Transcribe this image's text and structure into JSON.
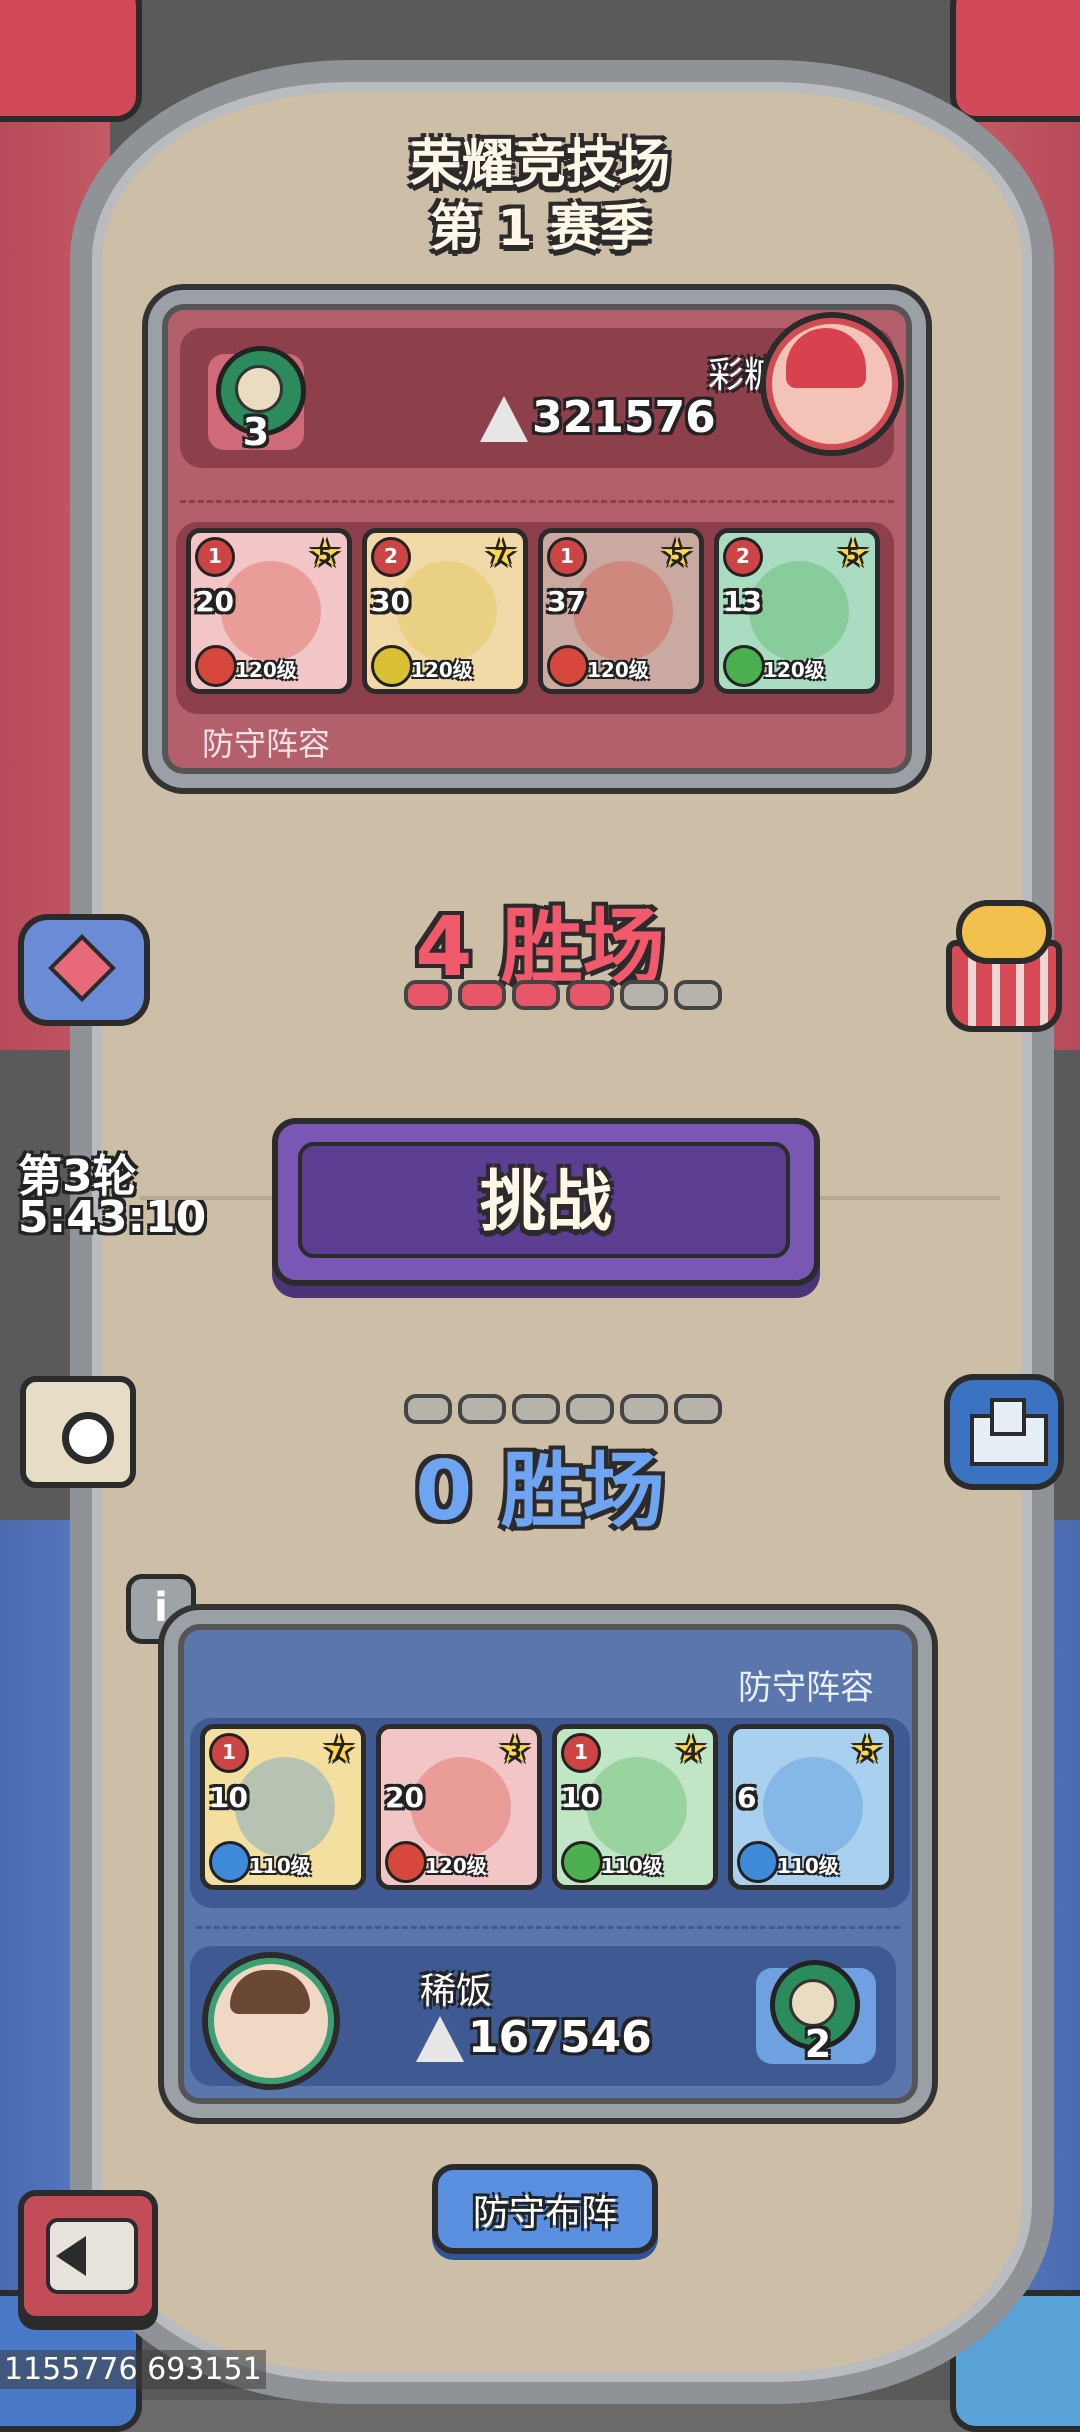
{
  "header": {
    "title": "荣耀竞技场",
    "season": "第 1 赛季"
  },
  "opponent": {
    "name": "彩糖",
    "power": "321576",
    "medal_count": "3",
    "lineup_label": "防守阵容",
    "heroes": [
      {
        "rank": "1",
        "stars": "5",
        "number": "20",
        "level": "120级",
        "element": "fire"
      },
      {
        "rank": "2",
        "stars": "7",
        "number": "30",
        "level": "120级",
        "element": "earth"
      },
      {
        "rank": "1",
        "stars": "5",
        "number": "37",
        "level": "120级",
        "element": "fire"
      },
      {
        "rank": "2",
        "stars": "5",
        "number": "13",
        "level": "120级",
        "element": "wind"
      }
    ]
  },
  "opponent_wins": {
    "label": "4 胜场",
    "filled": 4,
    "total": 6
  },
  "round": {
    "label": "第3轮",
    "timer": "5:43:10"
  },
  "challenge_button": "挑战",
  "player_wins": {
    "label": "0 胜场",
    "filled": 0,
    "total": 6
  },
  "player": {
    "name": "稀饭",
    "power": "167546",
    "medal_count": "2",
    "lineup_label": "防守阵容",
    "heroes": [
      {
        "rank": "1",
        "stars": "7",
        "number": "10",
        "level": "110级",
        "element": "water"
      },
      {
        "rank": "",
        "stars": "3",
        "number": "20",
        "level": "120级",
        "element": "fire"
      },
      {
        "rank": "1",
        "stars": "4",
        "number": "10",
        "level": "110级",
        "element": "wind"
      },
      {
        "rank": "",
        "stars": "5",
        "number": "6",
        "level": "110级",
        "element": "water"
      }
    ]
  },
  "defense_button": "防守布阵",
  "footer_id": "1155776 693151",
  "colors": {
    "red_accent": "#e8566a",
    "blue_accent": "#5b8fe0",
    "purple_button": "#8a63c4"
  }
}
